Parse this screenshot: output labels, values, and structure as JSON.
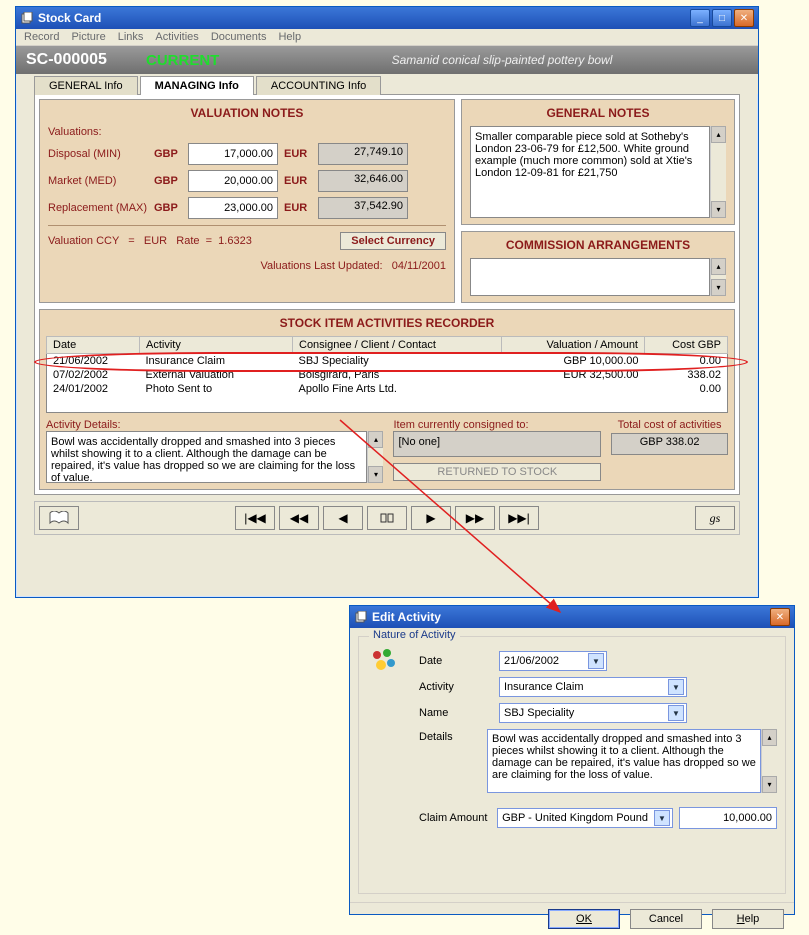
{
  "stockWindow": {
    "title": "Stock Card",
    "menus": [
      "Record",
      "Picture",
      "Links",
      "Activities",
      "Documents",
      "Help"
    ],
    "header": {
      "id": "SC-000005",
      "status": "CURRENT",
      "itemName": "Samanid conical slip-painted pottery bowl"
    },
    "tabs": {
      "general": "GENERAL Info",
      "managing": "MANAGING Info",
      "accounting": "ACCOUNTING Info"
    },
    "valuation": {
      "title": "VALUATION NOTES",
      "valuationsLabel": "Valuations:",
      "rows": [
        {
          "label": "Disposal (MIN)",
          "ccy1": "GBP",
          "val1": "17,000.00",
          "ccy2": "EUR",
          "val2": "27,749.10"
        },
        {
          "label": "Market (MED)",
          "ccy1": "GBP",
          "val1": "20,000.00",
          "ccy2": "EUR",
          "val2": "32,646.00"
        },
        {
          "label": "Replacement (MAX)",
          "ccy1": "GBP",
          "val1": "23,000.00",
          "ccy2": "EUR",
          "val2": "37,542.90"
        }
      ],
      "ccyLine": "Valuation CCY   =   EUR   Rate  =  1.6323",
      "selectCurrencyBtn": "Select Currency",
      "lastUpdatedLabel": "Valuations Last Updated:",
      "lastUpdatedDate": "04/11/2001"
    },
    "generalNotes": {
      "title": "GENERAL NOTES",
      "text": "Smaller comparable piece sold at Sotheby's London 23-06-79 for £12,500.  White ground example (much more common) sold at Xtie's London 12-09-81 for £21,750"
    },
    "commission": {
      "title": "COMMISSION ARRANGEMENTS",
      "text": ""
    },
    "activities": {
      "title": "STOCK ITEM ACTIVITIES RECORDER",
      "columns": [
        "Date",
        "Activity",
        "Consignee / Client / Contact",
        "Valuation / Amount",
        "Cost GBP"
      ],
      "rows": [
        {
          "date": "21/06/2002",
          "activity": "Insurance Claim",
          "contact": "SBJ Speciality",
          "amount": "GBP 10,000.00",
          "cost": "0.00"
        },
        {
          "date": "07/02/2002",
          "activity": "External Valuation",
          "contact": "Boisgirard, Paris",
          "amount": "EUR 32,500.00",
          "cost": "338.02"
        },
        {
          "date": "24/01/2002",
          "activity": "Photo Sent to",
          "contact": "Apollo Fine Arts Ltd.",
          "amount": "",
          "cost": "0.00"
        }
      ],
      "detailsLabel": "Activity Details:",
      "detailsText": "Bowl was accidentally dropped and smashed into 3 pieces whilst showing it to a client.  Although the damage can be repaired, it's value has dropped so we are claiming for the loss of value.",
      "consignedLabel": "Item currently consigned to:",
      "consignedValue": "[No one]",
      "returnedBtn": "RETURNED TO STOCK",
      "totalLabel": "Total cost of activities",
      "totalValue": "GBP 338.02"
    }
  },
  "editDialog": {
    "title": "Edit Activity",
    "group": "Nature of Activity",
    "labels": {
      "date": "Date",
      "activity": "Activity",
      "name": "Name",
      "details": "Details",
      "claim": "Claim Amount"
    },
    "values": {
      "date": "21/06/2002",
      "activity": "Insurance Claim",
      "name": "SBJ Speciality",
      "details": "Bowl was accidentally dropped and smashed into 3 pieces whilst showing it to a client.  Although the damage can be repaired, it's value has dropped so we are claiming for the loss of value.",
      "claimCcy": "GBP - United Kingdom Pound",
      "claimAmount": "10,000.00"
    },
    "buttons": {
      "ok": "OK",
      "cancel": "Cancel",
      "help": "Help"
    }
  }
}
